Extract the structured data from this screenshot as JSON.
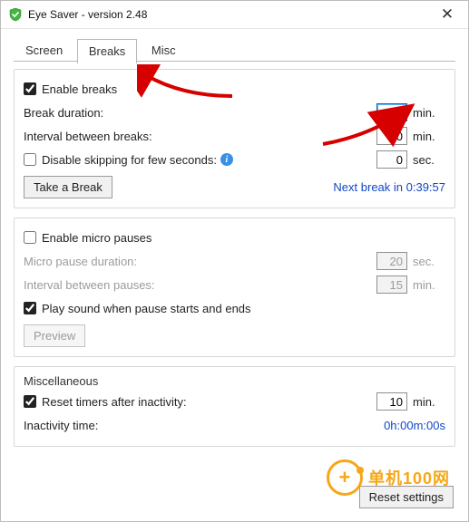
{
  "window": {
    "title": "Eye Saver - version 2.48"
  },
  "tabs": {
    "screen": "Screen",
    "breaks": "Breaks",
    "misc": "Misc"
  },
  "breaks": {
    "enable_label": "Enable breaks",
    "duration_label": "Break duration:",
    "duration_value": "5",
    "duration_unit": "min.",
    "interval_label": "Interval between breaks:",
    "interval_value": "40",
    "interval_unit": "min.",
    "disable_skip_label": "Disable skipping for few seconds:",
    "disable_skip_value": "0",
    "disable_skip_unit": "sec.",
    "take_break_btn": "Take a Break",
    "next_break_label": "Next break in 0:39:57"
  },
  "micro": {
    "enable_label": "Enable micro pauses",
    "duration_label": "Micro pause duration:",
    "duration_value": "20",
    "duration_unit": "sec.",
    "interval_label": "Interval between pauses:",
    "interval_value": "15",
    "interval_unit": "min.",
    "playsound_label": "Play sound when pause starts and ends",
    "preview_btn": "Preview"
  },
  "misc": {
    "heading": "Miscellaneous",
    "reset_label": "Reset timers after inactivity:",
    "reset_value": "10",
    "reset_unit": "min.",
    "inactivity_label": "Inactivity time:",
    "inactivity_value": "0h:00m:00s"
  },
  "footer": {
    "reset_btn": "Reset settings"
  },
  "watermark": {
    "text": "单机100网"
  }
}
